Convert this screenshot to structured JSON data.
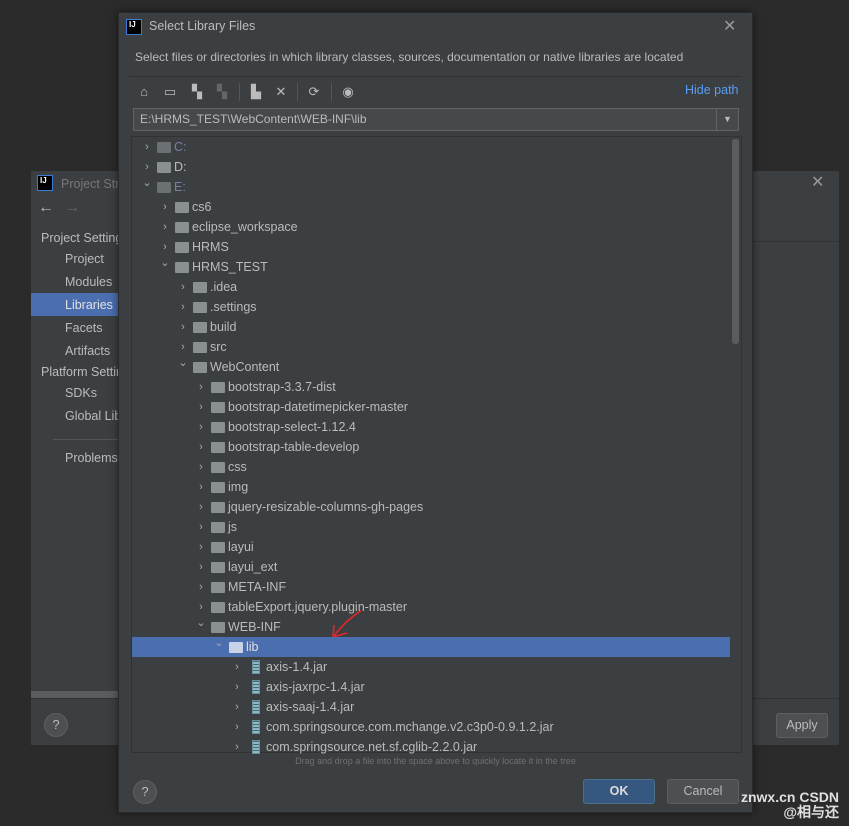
{
  "project_structure": {
    "title": "Project Structure",
    "group1": "Project Settings",
    "items1": [
      "Project",
      "Modules",
      "Libraries",
      "Facets",
      "Artifacts"
    ],
    "group2": "Platform Settings",
    "items2": [
      "SDKs",
      "Global Libraries"
    ],
    "problems": "Problems",
    "apply": "Apply",
    "help": "?"
  },
  "dialog": {
    "title": "Select Library Files",
    "description": "Select files or directories in which library classes, sources, documentation or native libraries are located",
    "hide_path": "Hide path",
    "path_value": "E:\\HRMS_TEST\\WebContent\\WEB-INF\\lib",
    "hint": "Drag and drop a file into the space above to quickly locate it in the tree",
    "ok": "OK",
    "cancel": "Cancel",
    "help": "?",
    "toolbar_icons": [
      "home-icon",
      "desktop-icon",
      "project-folder-icon",
      "module-folder-icon",
      "new-folder-icon",
      "delete-icon",
      "refresh-icon",
      "show-hidden-icon"
    ],
    "tree": [
      {
        "label": "C:",
        "level": 0,
        "expanded": false,
        "type": "drive",
        "dim": true
      },
      {
        "label": "D:",
        "level": 0,
        "expanded": false,
        "type": "drive"
      },
      {
        "label": "E:",
        "level": 0,
        "expanded": true,
        "type": "drive",
        "dim": true
      },
      {
        "label": "cs6",
        "level": 1,
        "expanded": false,
        "type": "folder"
      },
      {
        "label": "eclipse_workspace",
        "level": 1,
        "expanded": false,
        "type": "folder"
      },
      {
        "label": "HRMS",
        "level": 1,
        "expanded": false,
        "type": "folder"
      },
      {
        "label": "HRMS_TEST",
        "level": 1,
        "expanded": true,
        "type": "folder"
      },
      {
        "label": ".idea",
        "level": 2,
        "expanded": false,
        "type": "folder"
      },
      {
        "label": ".settings",
        "level": 2,
        "expanded": false,
        "type": "folder"
      },
      {
        "label": "build",
        "level": 2,
        "expanded": false,
        "type": "folder"
      },
      {
        "label": "src",
        "level": 2,
        "expanded": false,
        "type": "folder"
      },
      {
        "label": "WebContent",
        "level": 2,
        "expanded": true,
        "type": "folder"
      },
      {
        "label": "bootstrap-3.3.7-dist",
        "level": 3,
        "expanded": false,
        "type": "folder"
      },
      {
        "label": "bootstrap-datetimepicker-master",
        "level": 3,
        "expanded": false,
        "type": "folder"
      },
      {
        "label": "bootstrap-select-1.12.4",
        "level": 3,
        "expanded": false,
        "type": "folder"
      },
      {
        "label": "bootstrap-table-develop",
        "level": 3,
        "expanded": false,
        "type": "folder"
      },
      {
        "label": "css",
        "level": 3,
        "expanded": false,
        "type": "folder"
      },
      {
        "label": "img",
        "level": 3,
        "expanded": false,
        "type": "folder"
      },
      {
        "label": "jquery-resizable-columns-gh-pages",
        "level": 3,
        "expanded": false,
        "type": "folder"
      },
      {
        "label": "js",
        "level": 3,
        "expanded": false,
        "type": "folder"
      },
      {
        "label": "layui",
        "level": 3,
        "expanded": false,
        "type": "folder"
      },
      {
        "label": "layui_ext",
        "level": 3,
        "expanded": false,
        "type": "folder"
      },
      {
        "label": "META-INF",
        "level": 3,
        "expanded": false,
        "type": "folder"
      },
      {
        "label": "tableExport.jquery.plugin-master",
        "level": 3,
        "expanded": false,
        "type": "folder"
      },
      {
        "label": "WEB-INF",
        "level": 3,
        "expanded": true,
        "type": "folder"
      },
      {
        "label": "lib",
        "level": 4,
        "expanded": true,
        "type": "folder",
        "selected": true
      },
      {
        "label": "axis-1.4.jar",
        "level": 5,
        "expanded": false,
        "type": "jar"
      },
      {
        "label": "axis-jaxrpc-1.4.jar",
        "level": 5,
        "expanded": false,
        "type": "jar"
      },
      {
        "label": "axis-saaj-1.4.jar",
        "level": 5,
        "expanded": false,
        "type": "jar"
      },
      {
        "label": "com.springsource.com.mchange.v2.c3p0-0.9.1.2.jar",
        "level": 5,
        "expanded": false,
        "type": "jar"
      },
      {
        "label": "com.springsource.net.sf.cglib-2.2.0.jar",
        "level": 5,
        "expanded": false,
        "type": "jar"
      }
    ]
  },
  "watermark": "znwx.cn  CSDN @相与还",
  "colors": {
    "selection": "#4b6eaf",
    "link": "#589df6",
    "annotation_arrow": "#e0262b"
  }
}
